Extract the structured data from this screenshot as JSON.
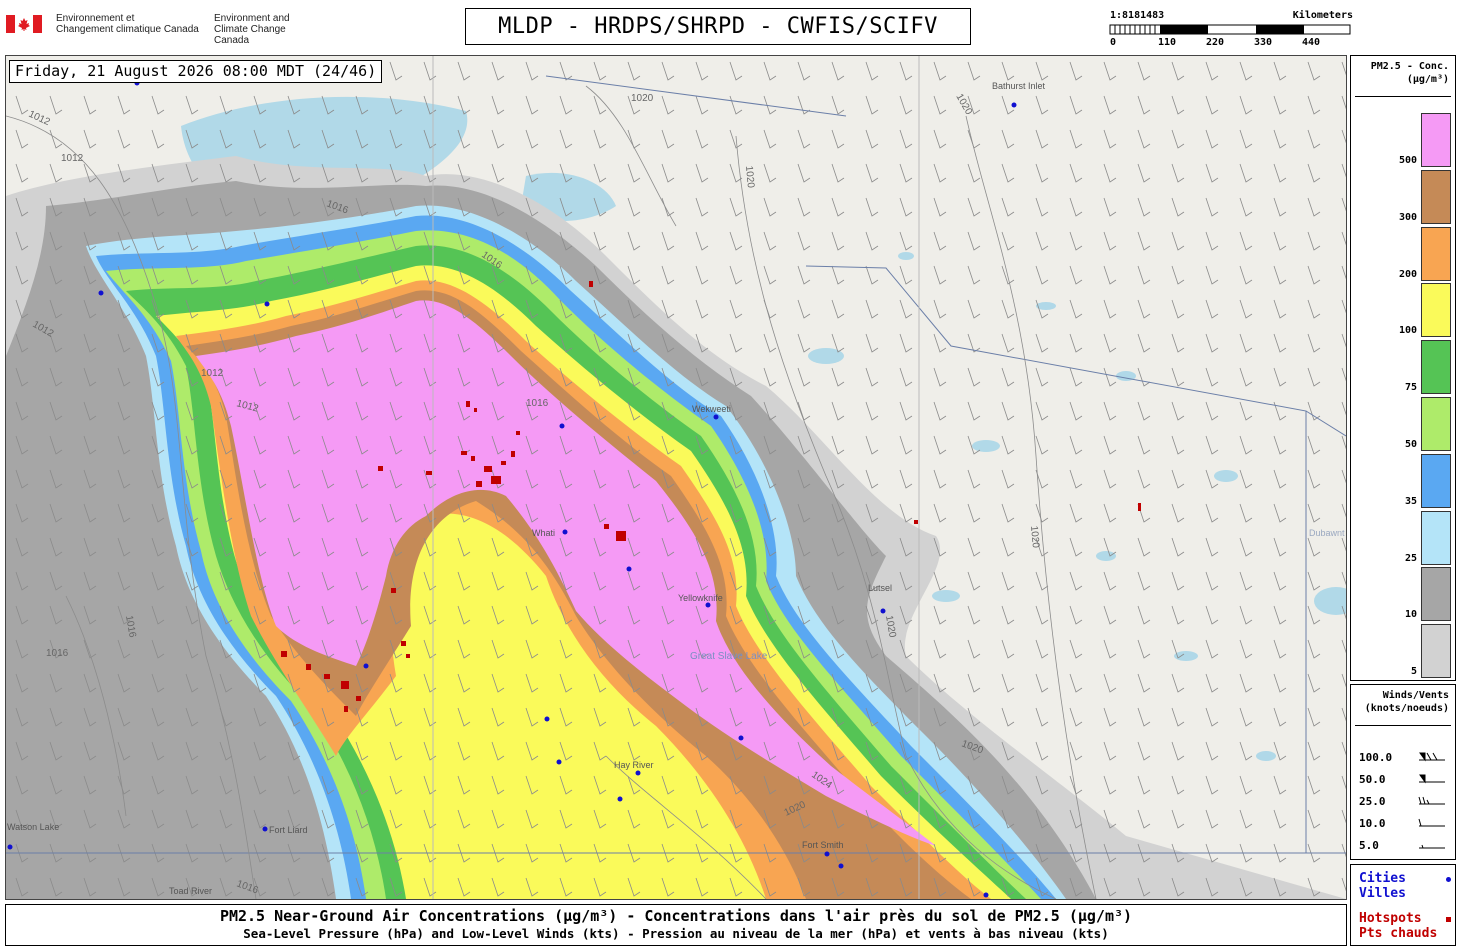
{
  "header": {
    "gov_fr_line1": "Environnement et",
    "gov_fr_line2": "Changement climatique Canada",
    "gov_en_line1": "Environment and",
    "gov_en_line2": "Climate Change Canada",
    "title": "MLDP - HRDPS/SHRPD - CWFIS/SCIFV"
  },
  "scale": {
    "ratio": "1:8181483",
    "unit": "Kilometers",
    "ticks": [
      "0",
      "110",
      "220",
      "330",
      "440"
    ]
  },
  "datetime": "Friday, 21 August 2026 08:00 MDT (24/46)",
  "legend_conc": {
    "title1": "PM2.5 - Conc.",
    "title2": "(µg/m³)",
    "levels": [
      {
        "label": "500",
        "color": "#f59af5"
      },
      {
        "label": "300",
        "color": "#c58a57"
      },
      {
        "label": "200",
        "color": "#f8a552"
      },
      {
        "label": "100",
        "color": "#fafa5a"
      },
      {
        "label": "75",
        "color": "#55c455"
      },
      {
        "label": "50",
        "color": "#aeeb6a"
      },
      {
        "label": "35",
        "color": "#5aa8f2"
      },
      {
        "label": "25",
        "color": "#b4e4f8"
      },
      {
        "label": "10",
        "color": "#a6a6a6"
      },
      {
        "label": "5",
        "color": "#d2d2d2"
      }
    ]
  },
  "legend_wind": {
    "title1": "Winds/Vents",
    "title2": "(knots/noeuds)",
    "rows": [
      "100.0",
      "50.0",
      "25.0",
      "10.0",
      "5.0"
    ]
  },
  "legend_symbols": {
    "cities": "Cities",
    "villes": "Villes",
    "hotspots": "Hotspots",
    "pts_chauds": "Pts chauds",
    "city_color": "#1010d0",
    "hotspot_color": "#c00000"
  },
  "footer": {
    "line1": "PM2.5 Near-Ground Air Concentrations (µg/m³) - Concentrations dans l'air près du sol de PM2.5 (µg/m³)",
    "line2": "Sea-Level Pressure (hPa) and Low-Level Winds (kts) - Pression au niveau de la mer (hPa) et vents à bas niveau (kts)"
  },
  "map": {
    "places": [
      "Bathurst Inlet",
      "Wekweeti",
      "Whati",
      "Yellowknife",
      "Lutsel",
      "Great Slave Lake",
      "Hay River",
      "Fort Liard",
      "Fort Smith",
      "Toad River",
      "Dubawnt Lake",
      "Watson Lake"
    ],
    "isobar_labels": [
      "1012",
      "1016",
      "1020",
      "1024"
    ]
  }
}
